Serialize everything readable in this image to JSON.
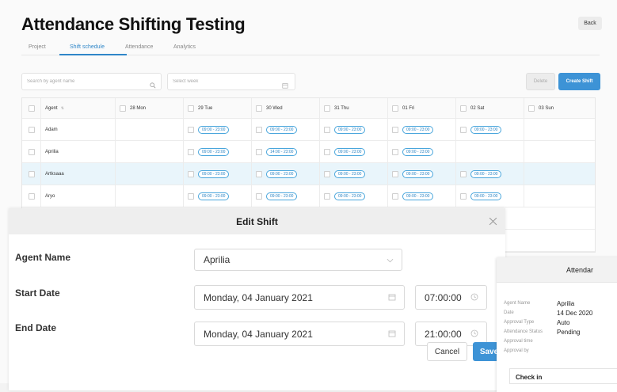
{
  "page": {
    "title": "Attendance Shifting Testing",
    "back_label": "Back"
  },
  "tabs": [
    {
      "label": "Project",
      "active": false
    },
    {
      "label": "Shift schedule",
      "active": true
    },
    {
      "label": "Attendance",
      "active": false
    },
    {
      "label": "Analytics",
      "active": false
    }
  ],
  "toolbar": {
    "search_placeholder": "Search by agent name",
    "week_placeholder": "Select week",
    "delete_label": "Delete",
    "create_label": "Create Shift"
  },
  "table": {
    "agent_header": "Agent",
    "days": [
      "28 Mon",
      "29 Tue",
      "30 Wed",
      "31 Thu",
      "01 Fri",
      "02 Sat",
      "03 Sun"
    ],
    "rows": [
      {
        "agent": "Adam",
        "shifts": [
          "",
          "09:00 - 23:00",
          "09:00 - 23:00",
          "09:00 - 23:00",
          "09:00 - 23:00",
          "09:00 - 23:00",
          ""
        ]
      },
      {
        "agent": "Aprilia",
        "shifts": [
          "",
          "09:00 - 23:00",
          "14:00 - 23:00",
          "09:00 - 23:00",
          "09:00 - 23:00",
          "",
          ""
        ]
      },
      {
        "agent": "Artksaaa",
        "shifts": [
          "",
          "09:00 - 23:00",
          "09:00 - 23:00",
          "09:00 - 23:00",
          "09:00 - 23:00",
          "09:00 - 23:00",
          ""
        ],
        "highlight": true
      },
      {
        "agent": "Aryo",
        "shifts": [
          "",
          "09:00 - 23:00",
          "09:00 - 23:00",
          "09:00 - 23:00",
          "09:00 - 23:00",
          "09:00 - 23:00",
          ""
        ]
      }
    ]
  },
  "modal": {
    "title": "Edit Shift",
    "agent_label": "Agent Name",
    "agent_value": "Aprilia",
    "start_label": "Start Date",
    "start_date": "Monday, 04 January 2021",
    "start_time": "07:00:00",
    "end_label": "End Date",
    "end_date": "Monday, 04 January 2021",
    "end_time": "21:00:00",
    "cancel_label": "Cancel",
    "save_label": "Save"
  },
  "side_panel": {
    "title": "Attendar",
    "fields": [
      {
        "label": "Agent Name",
        "value": "Aprilia"
      },
      {
        "label": "Date",
        "value": "14 Dec 2020"
      },
      {
        "label": "Approval Type",
        "value": "Auto"
      },
      {
        "label": "Attendance Status",
        "value": "Pending"
      },
      {
        "label": "Approval time",
        "value": ""
      },
      {
        "label": "Approval by",
        "value": ""
      }
    ],
    "checkin_label": "Check in"
  },
  "colors": {
    "accent": "#3d93d6",
    "highlight_row": "#e9f5fb"
  }
}
